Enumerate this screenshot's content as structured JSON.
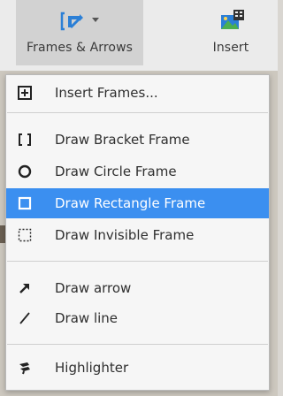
{
  "toolbar": {
    "frames_arrows_label": "Frames & Arrows",
    "insert_label": "Insert"
  },
  "menu": {
    "items": [
      {
        "label": "Insert Frames...",
        "icon": "add-frame-icon"
      },
      {
        "label": "Draw Bracket Frame",
        "icon": "bracket-frame-icon"
      },
      {
        "label": "Draw Circle Frame",
        "icon": "circle-frame-icon"
      },
      {
        "label": "Draw Rectangle Frame",
        "icon": "rectangle-frame-icon",
        "selected": true
      },
      {
        "label": "Draw Invisible Frame",
        "icon": "invisible-frame-icon"
      },
      {
        "label": "Draw arrow",
        "icon": "arrow-icon"
      },
      {
        "label": "Draw line",
        "icon": "line-icon"
      },
      {
        "label": "Highlighter",
        "icon": "highlighter-icon"
      }
    ]
  },
  "colors": {
    "accent": "#3b8ff0",
    "icon_blue": "#2b7fd6",
    "selected_text": "#ffffff"
  }
}
